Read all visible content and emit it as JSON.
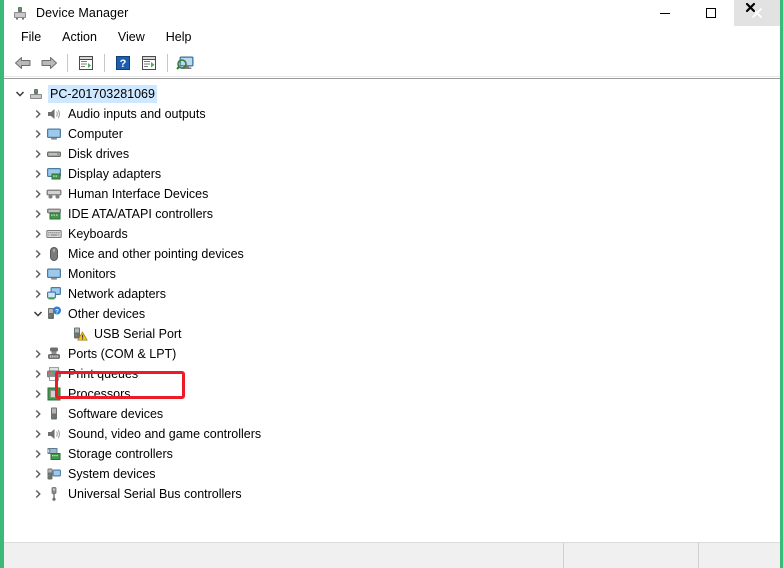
{
  "window": {
    "title": "Device Manager",
    "title_icon": "device-manager-icon",
    "frame_color": "#3cb878"
  },
  "caption_buttons": [
    {
      "name": "minimize",
      "glyph": "minimize-icon",
      "hovered": false
    },
    {
      "name": "maximize",
      "glyph": "maximize-icon",
      "hovered": false
    },
    {
      "name": "close",
      "glyph": "close-icon",
      "hovered": true
    }
  ],
  "menubar": {
    "items": [
      {
        "label": "File"
      },
      {
        "label": "Action"
      },
      {
        "label": "View"
      },
      {
        "label": "Help"
      }
    ]
  },
  "toolbar": {
    "buttons": [
      {
        "name": "back-button",
        "icon": "back-arrow-icon"
      },
      {
        "name": "forward-button",
        "icon": "forward-arrow-icon"
      },
      {
        "name": "separator-1",
        "icon": "separator"
      },
      {
        "name": "properties-button",
        "icon": "properties-icon"
      },
      {
        "name": "separator-2",
        "icon": "separator"
      },
      {
        "name": "help-button",
        "icon": "help-question-icon"
      },
      {
        "name": "update-driver-button",
        "icon": "update-driver-icon"
      },
      {
        "name": "separator-3",
        "icon": "separator"
      },
      {
        "name": "scan-hardware-changes-button",
        "icon": "scan-monitor-icon"
      }
    ]
  },
  "tree": {
    "nodes": [
      {
        "label": "PC-201703281069",
        "level": 0,
        "icon": "computer-root-icon",
        "twisty": "expanded",
        "selected": true
      },
      {
        "label": "Audio inputs and outputs",
        "level": 1,
        "icon": "speaker-icon",
        "twisty": "collapsed",
        "selected": false
      },
      {
        "label": "Computer",
        "level": 1,
        "icon": "monitor-icon",
        "twisty": "collapsed",
        "selected": false
      },
      {
        "label": "Disk drives",
        "level": 1,
        "icon": "disk-drive-icon",
        "twisty": "collapsed",
        "selected": false
      },
      {
        "label": "Display adapters",
        "level": 1,
        "icon": "display-adapter-icon",
        "twisty": "collapsed",
        "selected": false
      },
      {
        "label": "Human Interface Devices",
        "level": 1,
        "icon": "hid-icon",
        "twisty": "collapsed",
        "selected": false
      },
      {
        "label": "IDE ATA/ATAPI controllers",
        "level": 1,
        "icon": "ide-controller-icon",
        "twisty": "collapsed",
        "selected": false
      },
      {
        "label": "Keyboards",
        "level": 1,
        "icon": "keyboard-icon",
        "twisty": "collapsed",
        "selected": false
      },
      {
        "label": "Mice and other pointing devices",
        "level": 1,
        "icon": "mouse-icon",
        "twisty": "collapsed",
        "selected": false
      },
      {
        "label": "Monitors",
        "level": 1,
        "icon": "monitor-icon",
        "twisty": "collapsed",
        "selected": false
      },
      {
        "label": "Network adapters",
        "level": 1,
        "icon": "network-adapter-icon",
        "twisty": "collapsed",
        "selected": false
      },
      {
        "label": "Other devices",
        "level": 1,
        "icon": "unknown-device-icon",
        "twisty": "expanded",
        "selected": false
      },
      {
        "label": "USB Serial Port",
        "level": 2,
        "icon": "warning-device-icon",
        "twisty": "none",
        "selected": false
      },
      {
        "label": "Ports (COM & LPT)",
        "level": 1,
        "icon": "port-icon",
        "twisty": "collapsed",
        "selected": false
      },
      {
        "label": "Print queues",
        "level": 1,
        "icon": "printer-icon",
        "twisty": "collapsed",
        "selected": false
      },
      {
        "label": "Processors",
        "level": 1,
        "icon": "processor-icon",
        "twisty": "collapsed",
        "selected": false
      },
      {
        "label": "Software devices",
        "level": 1,
        "icon": "software-device-icon",
        "twisty": "collapsed",
        "selected": false
      },
      {
        "label": "Sound, video and game controllers",
        "level": 1,
        "icon": "speaker-icon",
        "twisty": "collapsed",
        "selected": false
      },
      {
        "label": "Storage controllers",
        "level": 1,
        "icon": "storage-controller-icon",
        "twisty": "collapsed",
        "selected": false
      },
      {
        "label": "System devices",
        "level": 1,
        "icon": "system-device-icon",
        "twisty": "collapsed",
        "selected": false
      },
      {
        "label": "Universal Serial Bus controllers",
        "level": 1,
        "icon": "usb-controller-icon",
        "twisty": "collapsed",
        "selected": false
      }
    ]
  },
  "annotation": {
    "name": "usb-serial-port-highlight",
    "color": "#ed1c24",
    "target_label": "USB Serial Port"
  },
  "statusbar": {
    "panels": [
      {
        "text": ""
      },
      {
        "text": ""
      },
      {
        "text": ""
      }
    ]
  },
  "cursor": {
    "name": "mouse-cursor",
    "shape": "arrow-x"
  }
}
